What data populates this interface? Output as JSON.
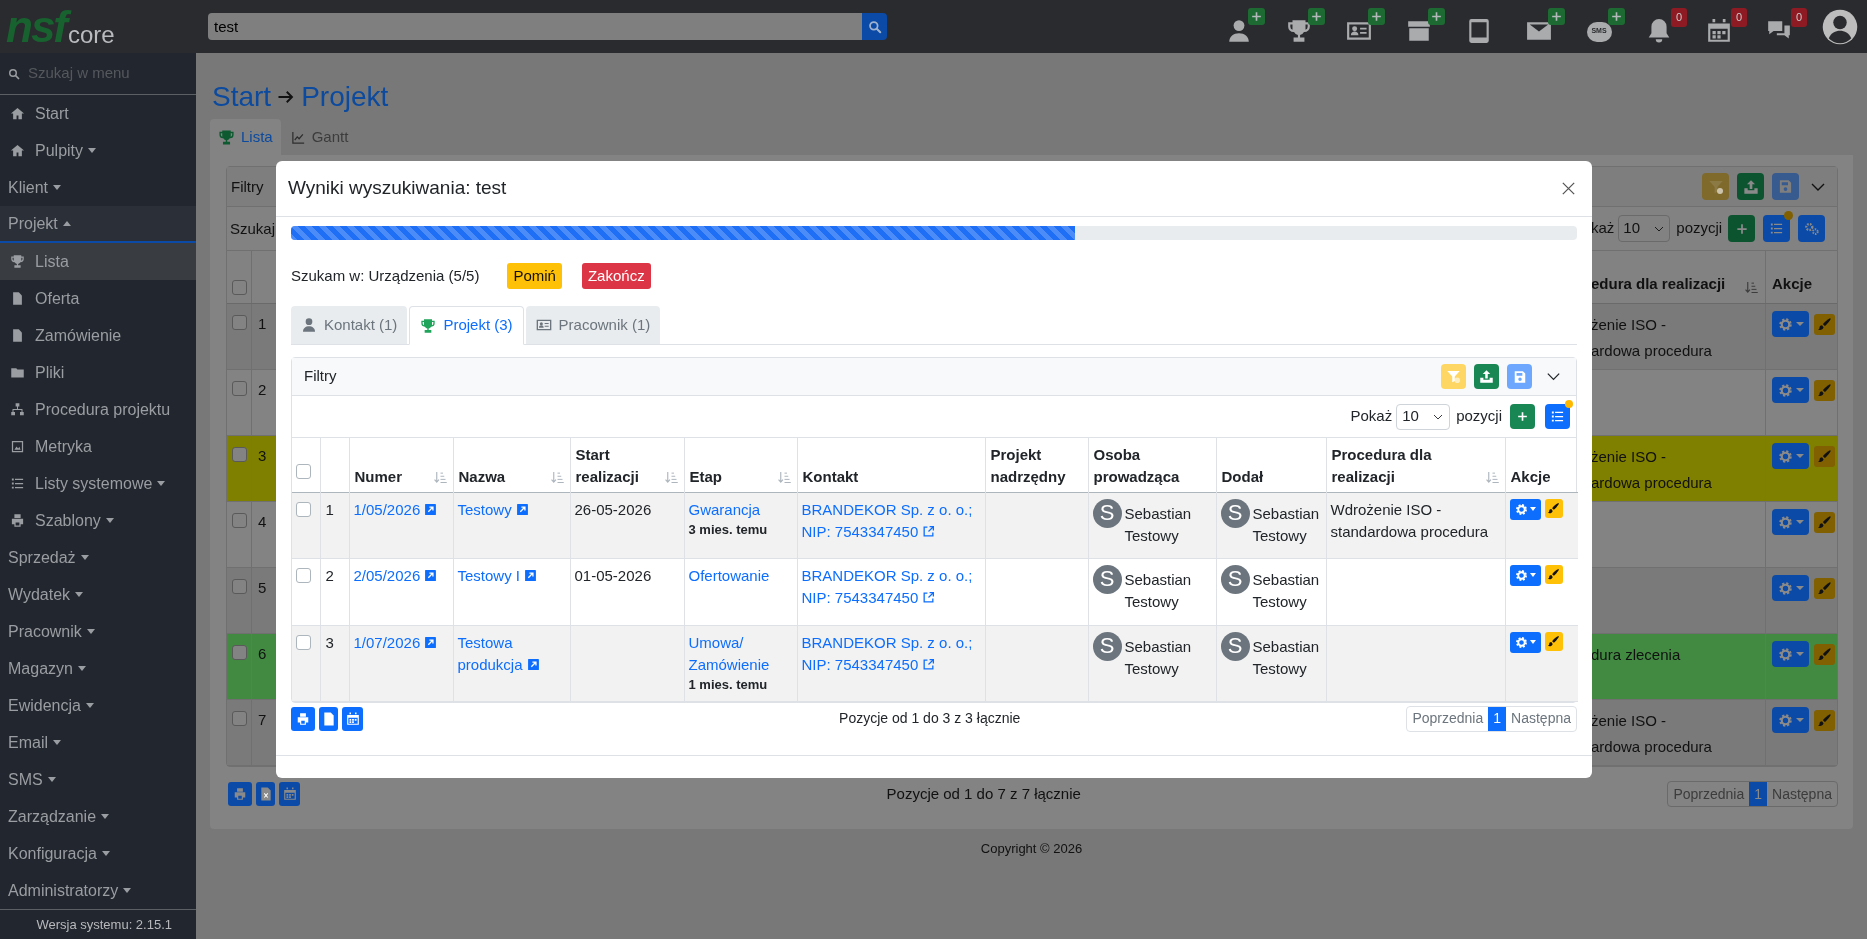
{
  "topbar": {
    "logo": {
      "mark": "nsf",
      "text": "core"
    },
    "search": {
      "value": "test"
    },
    "icons": [
      {
        "plus": true
      },
      {
        "plus": true
      },
      {
        "plus": true
      },
      {
        "plus": true
      },
      {
        "plus": false
      },
      {
        "plus": true
      },
      {
        "plus": true,
        "label": "SMS"
      },
      {
        "plus": false,
        "badge": "0"
      },
      {
        "plus": false,
        "badge": "0"
      },
      {
        "plus": false,
        "badge": "0"
      },
      {
        "plus": false
      }
    ]
  },
  "sidebar": {
    "search": {
      "placeholder": "Szukaj w menu"
    },
    "items": [
      {
        "label": "Start",
        "kind": "link",
        "selected": false
      },
      {
        "label": "Pulpity",
        "kind": "link",
        "expanded": false,
        "selected": false
      },
      {
        "label": "Klient",
        "kind": "section",
        "expanded": false,
        "selected": false
      },
      {
        "label": "Projekt",
        "kind": "section",
        "expanded": true,
        "selected": false
      },
      {
        "label": "Lista",
        "kind": "link",
        "selected": true
      },
      {
        "label": "Oferta",
        "kind": "link",
        "selected": false
      },
      {
        "label": "Zamówienie",
        "kind": "link",
        "selected": false
      },
      {
        "label": "Pliki",
        "kind": "link",
        "selected": false
      },
      {
        "label": "Procedura projektu",
        "kind": "link",
        "selected": false
      },
      {
        "label": "Metryka",
        "kind": "link",
        "selected": false
      },
      {
        "label": "Listy systemowe",
        "kind": "link",
        "expanded": false,
        "selected": false
      },
      {
        "label": "Szablony",
        "kind": "link",
        "expanded": false,
        "selected": false
      },
      {
        "label": "Sprzedaż",
        "kind": "section",
        "expanded": false,
        "selected": false
      },
      {
        "label": "Wydatek",
        "kind": "section",
        "expanded": false,
        "selected": false
      },
      {
        "label": "Pracownik",
        "kind": "section",
        "expanded": false,
        "selected": false
      },
      {
        "label": "Magazyn",
        "kind": "section",
        "expanded": false,
        "selected": false
      },
      {
        "label": "Ewidencja",
        "kind": "section",
        "expanded": false,
        "selected": false
      },
      {
        "label": "Email",
        "kind": "section",
        "expanded": false,
        "selected": false
      },
      {
        "label": "SMS",
        "kind": "section",
        "expanded": false,
        "selected": false
      },
      {
        "label": "Zarządzanie",
        "kind": "section",
        "expanded": false,
        "selected": false
      },
      {
        "label": "Konfiguracja",
        "kind": "section",
        "expanded": false,
        "selected": false
      },
      {
        "label": "Administratorzy",
        "kind": "section",
        "expanded": false,
        "selected": false
      }
    ],
    "version": "Wersja systemu: 2.15.1"
  },
  "page": {
    "breadcrumb": [
      "Start",
      "Projekt"
    ],
    "tabs": [
      {
        "label": "Lista",
        "selected": true
      },
      {
        "label": "Gantt",
        "selected": false
      }
    ],
    "list": {
      "filters_title": "Filtry",
      "search_label": "Szukaj",
      "show": {
        "label": "każ",
        "value": "10",
        "suffix": "pozycji"
      },
      "columns": [
        {
          "label": "edura dla realizacji",
          "sortable": true
        },
        {
          "label": "Akcje",
          "sortable": false
        }
      ],
      "header_checked": false,
      "rows": [
        {
          "index": "1",
          "checked": false,
          "procedure": [
            "żenie ISO -",
            "ardowa procedura"
          ]
        },
        {
          "index": "2",
          "checked": false
        },
        {
          "index": "3",
          "checked": false,
          "color": "#7f7f00",
          "procedure": [
            "żenie ISO -",
            "ardowa procedura"
          ]
        },
        {
          "index": "4",
          "checked": false
        },
        {
          "index": "5",
          "checked": false
        },
        {
          "index": "6",
          "checked": false,
          "color": "#428a42",
          "procedure": [
            "dura zlecenia"
          ]
        },
        {
          "index": "7",
          "checked": false,
          "procedure": [
            "żenie ISO -",
            "ardowa procedura"
          ]
        }
      ],
      "summary": "Pozycje od 1 do 7 z 7 łącznie",
      "pagination": [
        {
          "label": "Poprzednia",
          "selected": false
        },
        {
          "label": "1",
          "selected": true
        },
        {
          "label": "Następna",
          "selected": false
        }
      ]
    },
    "copyright": "Copyright © 2026"
  },
  "modal": {
    "title": "Wyniki wyszukiwania: test",
    "progress": {
      "level": 0.61
    },
    "status": "Szukam w: Urządzenia (5/5)",
    "buttons": [
      {
        "label": "Pomiń",
        "kind": "warning"
      },
      {
        "label": "Zakończ",
        "kind": "danger"
      }
    ],
    "tabs": [
      {
        "label": "Kontakt (1)",
        "selected": false
      },
      {
        "label": "Projekt (3)",
        "selected": true
      },
      {
        "label": "Pracownik (1)",
        "selected": false
      }
    ],
    "filters_title": "Filtry",
    "show": {
      "label": "Pokaż",
      "value": "10",
      "suffix": "pozycji"
    },
    "header_checked": false,
    "columns": [
      {
        "label": "Numer",
        "sortable": true
      },
      {
        "label": "Nazwa",
        "sortable": true
      },
      {
        "label": "Start realizacji",
        "sortable": true
      },
      {
        "label": "Etap",
        "sortable": true
      },
      {
        "label": "Kontakt",
        "sortable": false
      },
      {
        "label": "Projekt nadrzędny",
        "sortable": false
      },
      {
        "label": "Osoba prowadząca",
        "sortable": false
      },
      {
        "label": "Dodał",
        "sortable": false
      },
      {
        "label": "Procedura dla realizacji",
        "sortable": true
      },
      {
        "label": "Akcje",
        "sortable": false
      }
    ],
    "rows": [
      {
        "checked": false,
        "index": "1",
        "number": "1/05/2026",
        "name": "Testowy",
        "start": "26-05-2026",
        "stage": "Gwarancja",
        "stage_age": "3 mies. temu",
        "contact": "BRANDEKOR Sp. z o. o.; NIP: 7543347450",
        "lead": {
          "initial": "S",
          "name": "Sebastian Testowy"
        },
        "added_by": {
          "initial": "S",
          "name": "Sebastian Testowy"
        },
        "procedure": "Wdrożenie ISO - standardowa procedura"
      },
      {
        "checked": false,
        "index": "2",
        "number": "2/05/2026",
        "name": "Testowy I",
        "start": "01-05-2026",
        "stage": "Ofertowanie",
        "contact": "BRANDEKOR Sp. z o. o.; NIP: 7543347450",
        "lead": {
          "initial": "S",
          "name": "Sebastian Testowy"
        },
        "added_by": {
          "initial": "S",
          "name": "Sebastian Testowy"
        }
      },
      {
        "checked": false,
        "index": "3",
        "number": "1/07/2026",
        "name": "Testowa produkcja",
        "stage": "Umowa/ Zamówienie",
        "stage_age": "1 mies. temu",
        "contact": "BRANDEKOR Sp. z o. o.; NIP: 7543347450",
        "lead": {
          "initial": "S",
          "name": "Sebastian Testowy"
        },
        "added_by": {
          "initial": "S",
          "name": "Sebastian Testowy"
        }
      }
    ],
    "summary": "Pozycje od 1 do 3 z 3 łącznie",
    "pagination": [
      {
        "label": "Poprzednia",
        "selected": false
      },
      {
        "label": "1",
        "selected": true
      },
      {
        "label": "Następna",
        "selected": false
      }
    ]
  }
}
